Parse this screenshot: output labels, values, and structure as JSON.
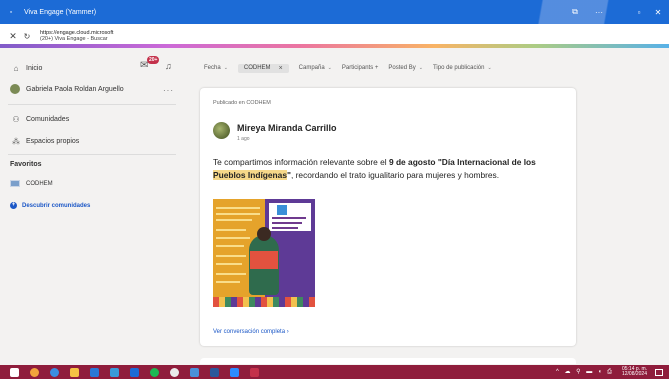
{
  "window": {
    "title": "Viva Engage (Yammer)",
    "controls": {
      "minimize": "—",
      "maximize": "▫",
      "close": "✕",
      "extra": "⧉",
      "more": "···"
    }
  },
  "address": {
    "url": "https://engage.cloud.microsoft",
    "page_title": "(20+) Viva Engage - Buscar"
  },
  "sidebar": {
    "home": "Inicio",
    "notification_count": "20+",
    "user_name": "Gabriela Paola Roldan Arguello",
    "more": "···",
    "communities": "Comunidades",
    "own_spaces": "Espacios propios",
    "favorites_title": "Favoritos",
    "favorite_community": "CODHEM",
    "discover": "Descubrir comunidades"
  },
  "filters": {
    "date": "Fecha",
    "selected": "CODHEM",
    "campaign": "Campaña",
    "participants": "Participants +",
    "posted_by": "Posted By",
    "post_type": "Tipo de publicación"
  },
  "post": {
    "posted_in": "Publicado en CODHEM",
    "author": "Mireya Miranda Carrillo",
    "time": "1 ago",
    "text_intro": "Te compartimos información relevante sobre el ",
    "text_date": "9 de agosto",
    "text_quote_open": " \"Día Internacional de los ",
    "text_highlight": "Pueblos Indígenas",
    "text_quote_close": "\"",
    "text_outro": ", recordando el trato igualitario para mujeres y hombres.",
    "link": "Ver conversación completa"
  },
  "taskbar": {
    "clock_time": "05:14 p. m.",
    "clock_date": "12/08/2024",
    "tray_icons": "^ ☁ ⚲ ▬ ◖ ⎙"
  },
  "colors": {
    "titlebar": "#1c6bd6",
    "taskbar": "#8f1d3c",
    "accent_link": "#1c58c7",
    "badge": "#c4314b",
    "highlight": "#f6d889"
  }
}
